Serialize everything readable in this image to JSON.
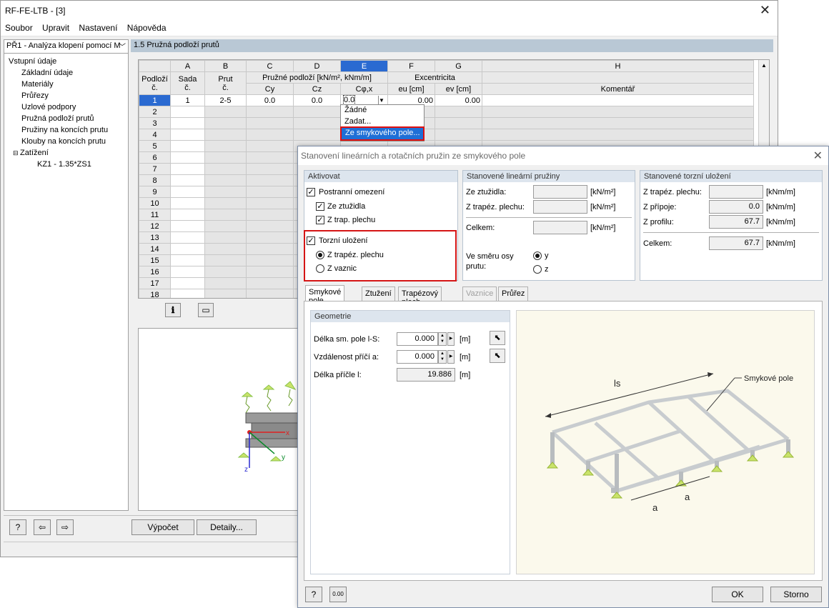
{
  "window": {
    "title": "RF-FE-LTB - [3]"
  },
  "menu": [
    "Soubor",
    "Upravit",
    "Nastavení",
    "Nápověda"
  ],
  "nav": {
    "case_combo": "PŘ1 - Analýza klopení pomocí M",
    "items": [
      {
        "label": "Vstupní údaje",
        "level": 0
      },
      {
        "label": "Základní údaje",
        "level": 1
      },
      {
        "label": "Materiály",
        "level": 1
      },
      {
        "label": "Průřezy",
        "level": 1
      },
      {
        "label": "Uzlové podpory",
        "level": 1
      },
      {
        "label": "Pružná podloží prutů",
        "level": 1
      },
      {
        "label": "Pružiny na koncích prutu",
        "level": 1
      },
      {
        "label": "Klouby na koncích prutu",
        "level": 1
      },
      {
        "label": "Zatížení",
        "level": 1
      },
      {
        "label": "KZ1 - 1.35*ZS1",
        "level": 2
      }
    ]
  },
  "section_title": "1.5 Pružná podloží prutů",
  "table": {
    "col_letters": [
      "A",
      "B",
      "C",
      "D",
      "E",
      "F",
      "G",
      "H"
    ],
    "rownum_header": [
      "Podloží",
      "č."
    ],
    "group_elastic": "Pružné podloží  [kN/m², kNm/m]",
    "group_ecc": "Excentricita",
    "sub_a": [
      "Sada",
      "č."
    ],
    "sub_b": [
      "Prut",
      "č."
    ],
    "sub_c": "Cy",
    "sub_d": "Cz",
    "sub_e": "Cφ,x",
    "sub_f": "eu [cm]",
    "sub_g": "ev [cm]",
    "sub_h": "Komentář",
    "row1": {
      "num": "1",
      "set": "1",
      "member": "2-5",
      "cy": "0.0",
      "cz": "0.0",
      "cphi": "0.0",
      "eu": "0.00",
      "ev": "0.00"
    },
    "rows": [
      "2",
      "3",
      "4",
      "5",
      "6",
      "7",
      "8",
      "9",
      "10",
      "11",
      "12",
      "13",
      "14",
      "15",
      "16",
      "17",
      "18"
    ]
  },
  "dropdown": [
    "Žádné",
    "Zadat...",
    "Ze smykového pole..."
  ],
  "bottom": {
    "calc_label": "Výpočet",
    "details_label": "Detaily..."
  },
  "dialog": {
    "title": "Stanovení lineárních a rotačních pružin ze smykového pole",
    "activate": {
      "header": "Aktivovat",
      "lateral": "Postranní omezení",
      "from_bracing": "Ze ztužidla",
      "from_sheet": "Z trap. plechu",
      "torsional": "Torzní uložení",
      "radio_sheet": "Z trapéz. plechu",
      "radio_purlins": "Z vaznic"
    },
    "linear": {
      "header": "Stanovené lineární pružiny",
      "from_bracing": "Ze ztužidla:",
      "from_sheet": "Z trapéz. plechu:",
      "total": "Celkem:",
      "unit": "[kN/m²]",
      "direction": "Ve směru osy prutu:",
      "axis_y": "y",
      "axis_z": "z"
    },
    "torsional": {
      "header": "Stanovené torzní uložení",
      "from_sheet": "Z trapéz. plechu:",
      "from_conn": "Z přípoje:",
      "from_profile": "Z profilu:",
      "total": "Celkem:",
      "unit": "[kNm/m]",
      "conn_value": "0.0",
      "profile_value": "67.7",
      "total_value": "67.7"
    },
    "tabs": [
      "Smykové pole",
      "Ztužení",
      "Trapézový plech",
      "Vaznice",
      "Průřez"
    ],
    "geometry": {
      "header": "Geometrie",
      "len_label": "Délka sm. pole l-S:",
      "len_value": "0.000",
      "dist_label": "Vzdálenost příčí a:",
      "dist_value": "0.000",
      "beam_label": "Délka příčle l:",
      "beam_value": "19.886",
      "unit": "[m]"
    },
    "figure": {
      "field_label": "Smykové pole",
      "ls_label": "ls",
      "a_label": "a"
    },
    "ok_label": "OK",
    "cancel_label": "Storno"
  }
}
